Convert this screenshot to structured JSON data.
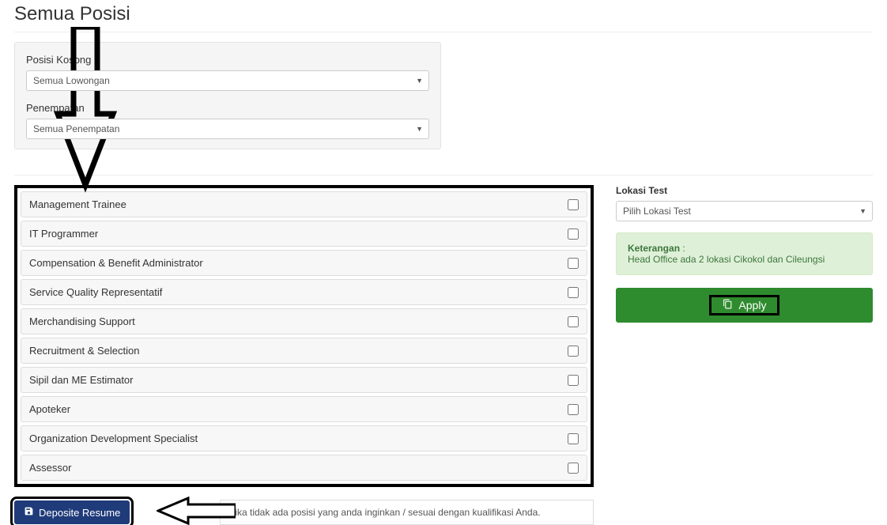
{
  "page": {
    "title": "Semua Posisi"
  },
  "filters": {
    "vacancy_label": "Posisi Kosong",
    "vacancy_value": "Semua Lowongan",
    "placement_label": "Penempatan",
    "placement_value": "Semua Penempatan"
  },
  "positions": [
    {
      "label": "Management Trainee"
    },
    {
      "label": "IT Programmer"
    },
    {
      "label": "Compensation & Benefit Administrator"
    },
    {
      "label": "Service Quality Representatif"
    },
    {
      "label": "Merchandising Support"
    },
    {
      "label": "Recruitment & Selection"
    },
    {
      "label": "Sipil dan ME Estimator"
    },
    {
      "label": "Apoteker"
    },
    {
      "label": "Organization Development Specialist"
    },
    {
      "label": "Assessor"
    }
  ],
  "sidebar": {
    "location_label": "Lokasi Test",
    "location_value": "Pilih Lokasi Test",
    "info_title": "Keterangan",
    "info_text": "Head Office ada 2 lokasi Cikokol dan Cileungsi",
    "apply_label": "Apply"
  },
  "deposit": {
    "button_label": "Deposite Resume",
    "note_text": "Jika tidak ada posisi yang anda inginkan / sesuai dengan kualifikasi Anda."
  }
}
